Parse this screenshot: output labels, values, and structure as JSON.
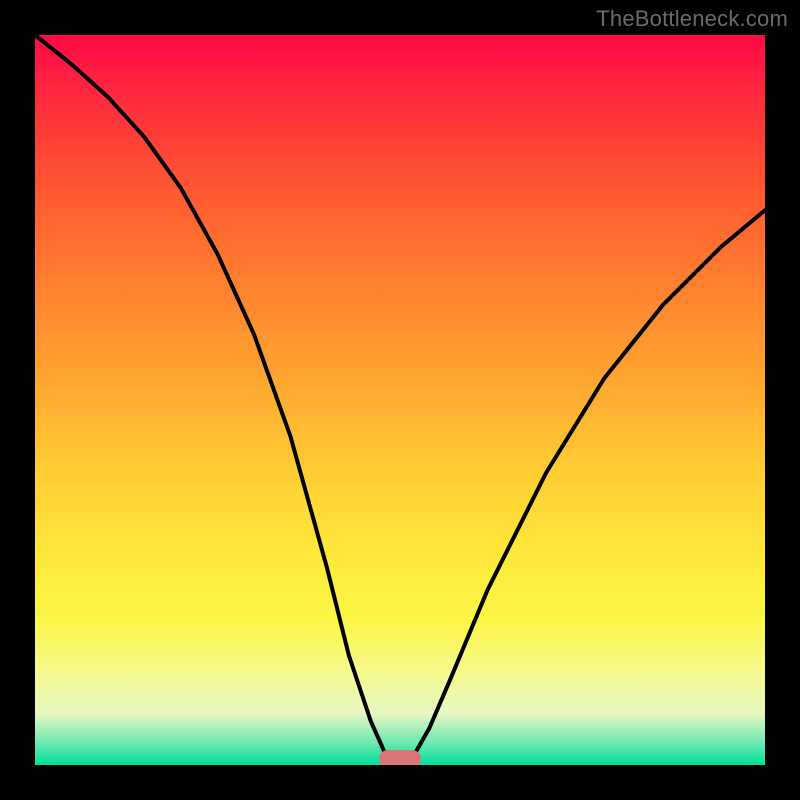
{
  "watermark": "TheBottleneck.com",
  "colors": {
    "frame_bg": "#000000",
    "watermark_text": "#6b6b6b",
    "curve_stroke": "#000000",
    "marker_fill": "#db7474",
    "gradient_top": "#ff0946",
    "gradient_bottom": "#00df9c"
  },
  "chart_data": {
    "type": "line",
    "title": "",
    "xlabel": "",
    "ylabel": "",
    "xlim": [
      0,
      100
    ],
    "ylim": [
      0,
      100
    ],
    "note": "axes untitled & unticked; values are relative positions (0–100) estimated from pixel geometry. y=0 is bottom (green), y=100 is top (red). Curve descends from top-left, reaches ≈0 near x≈50, rises toward top-right.",
    "series": [
      {
        "name": "curve",
        "x": [
          0,
          5,
          10,
          15,
          20,
          25,
          30,
          35,
          40,
          43,
          46,
          48,
          50,
          52,
          54,
          57,
          62,
          70,
          78,
          86,
          94,
          100
        ],
        "y": [
          100,
          96,
          91.5,
          86,
          79,
          70,
          59,
          45,
          27,
          15,
          6,
          1.5,
          0.5,
          1.5,
          5,
          12,
          24,
          40,
          53,
          63,
          71,
          76
        ]
      }
    ],
    "marker": {
      "x": 50,
      "y": 0.8
    },
    "background_gradient": {
      "direction": "vertical",
      "stops": [
        {
          "pos": 0.0,
          "color": "#ff0946"
        },
        {
          "pos": 0.15,
          "color": "#ff4236"
        },
        {
          "pos": 0.35,
          "color": "#ff832f"
        },
        {
          "pos": 0.58,
          "color": "#ffc833"
        },
        {
          "pos": 0.8,
          "color": "#fcf645"
        },
        {
          "pos": 0.93,
          "color": "#e6f7c2"
        },
        {
          "pos": 1.0,
          "color": "#00df9c"
        }
      ]
    }
  }
}
